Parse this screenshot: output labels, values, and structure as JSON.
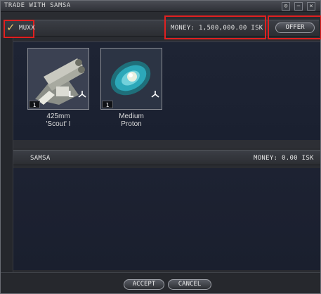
{
  "window": {
    "title": "TRADE WITH SAMSA"
  },
  "title_buttons": {
    "pin": "⊙",
    "minimize": "−",
    "close": "×"
  },
  "my_side": {
    "name": "MUXX",
    "money": "MONEY: 1,500,000.00 ISK",
    "offer_label": "OFFER",
    "items": [
      {
        "name_line1": "425mm",
        "name_line2": "'Scout' I",
        "quantity": "1",
        "slot": "L",
        "icon": "turret-icon"
      },
      {
        "name_line1": "Medium",
        "name_line2": "Proton",
        "quantity": "1",
        "slot": "",
        "icon": "proton-charge-icon"
      }
    ]
  },
  "their_side": {
    "name": "SAMSA",
    "money": "MONEY: 0.00 ISK"
  },
  "footer": {
    "accept_label": "ACCEPT",
    "cancel_label": "CANCEL"
  },
  "colors": {
    "highlight": "#e02020",
    "checkmark": "#e6c46a",
    "panel": "#1e2434"
  }
}
